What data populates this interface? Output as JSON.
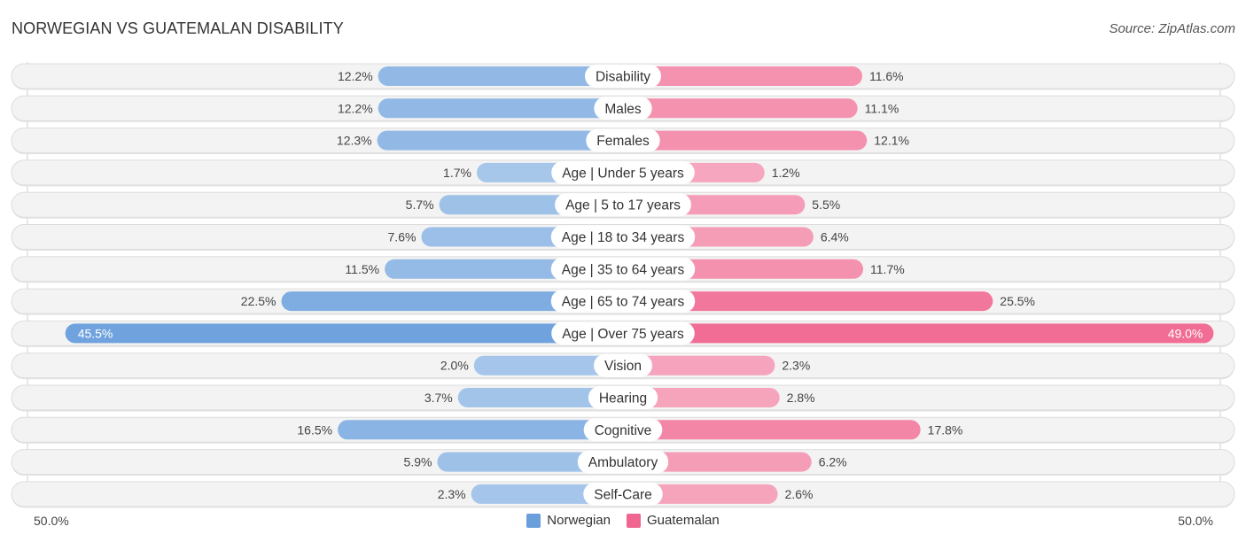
{
  "header": {
    "title": "NORWEGIAN VS GUATEMALAN DISABILITY",
    "source": "Source: ZipAtlas.com"
  },
  "colors": {
    "norwegian_strong": "#6a9fdc",
    "norwegian_light": "#a9c8eb",
    "guatemalan_strong": "#f06690",
    "guatemalan_light": "#f6a8c0"
  },
  "axis": {
    "left_label": "50.0%",
    "right_label": "50.0%"
  },
  "legend": {
    "items": [
      {
        "label": "Norwegian",
        "color": "#6a9fdc"
      },
      {
        "label": "Guatemalan",
        "color": "#f06690"
      }
    ]
  },
  "chart_data": {
    "type": "bar",
    "orientation": "horizontal-diverging",
    "title": "NORWEGIAN VS GUATEMALAN DISABILITY",
    "xlabel": "",
    "ylabel": "",
    "xlim": [
      -50,
      50
    ],
    "legend_position": "bottom-center",
    "categories": [
      "Disability",
      "Males",
      "Females",
      "Age | Under 5 years",
      "Age | 5 to 17 years",
      "Age | 18 to 34 years",
      "Age | 35 to 64 years",
      "Age | 65 to 74 years",
      "Age | Over 75 years",
      "Vision",
      "Hearing",
      "Cognitive",
      "Ambulatory",
      "Self-Care"
    ],
    "series": [
      {
        "name": "Norwegian",
        "side": "left",
        "values": [
          12.2,
          12.2,
          12.3,
          1.7,
          5.7,
          7.6,
          11.5,
          22.5,
          45.5,
          2.0,
          3.7,
          16.5,
          5.9,
          2.3
        ],
        "labels": [
          "12.2%",
          "12.2%",
          "12.3%",
          "1.7%",
          "5.7%",
          "7.6%",
          "11.5%",
          "22.5%",
          "45.5%",
          "2.0%",
          "3.7%",
          "16.5%",
          "5.9%",
          "2.3%"
        ]
      },
      {
        "name": "Guatemalan",
        "side": "right",
        "values": [
          11.6,
          11.1,
          12.1,
          1.2,
          5.5,
          6.4,
          11.7,
          25.5,
          49.0,
          2.3,
          2.8,
          17.8,
          6.2,
          2.6
        ],
        "labels": [
          "11.6%",
          "11.1%",
          "12.1%",
          "1.2%",
          "5.5%",
          "6.4%",
          "11.7%",
          "25.5%",
          "49.0%",
          "2.3%",
          "2.8%",
          "17.8%",
          "6.2%",
          "2.6%"
        ]
      }
    ]
  }
}
